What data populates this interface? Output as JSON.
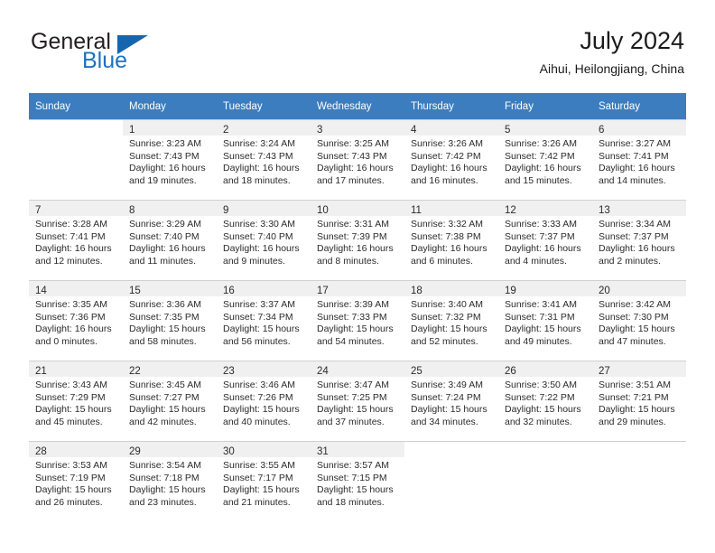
{
  "brand": {
    "word_one": "General",
    "word_two": "Blue",
    "triangle_icon": "triangle-icon",
    "colors": {
      "blue": "#1f72bd",
      "triangle": "#1566ae",
      "dark": "#231f20"
    }
  },
  "header": {
    "title": "July 2024",
    "subtitle": "Aihui, Heilongjiang, China"
  },
  "theme": {
    "header_row_bg": "#3b7dbf",
    "header_row_text": "#ffffff",
    "daynum_band_bg": "#f0f0f0",
    "grid_line": "#c8c8c8"
  },
  "weekdays": [
    "Sunday",
    "Monday",
    "Tuesday",
    "Wednesday",
    "Thursday",
    "Friday",
    "Saturday"
  ],
  "labels": {
    "sunrise": "Sunrise:",
    "sunset": "Sunset:",
    "daylight": "Daylight:"
  },
  "weeks": [
    [
      {
        "day": "",
        "sunrise": "",
        "sunset": "",
        "daylight_line1": "",
        "daylight_line2": ""
      },
      {
        "day": "1",
        "sunrise": "Sunrise: 3:23 AM",
        "sunset": "Sunset: 7:43 PM",
        "daylight_line1": "Daylight: 16 hours",
        "daylight_line2": "and 19 minutes."
      },
      {
        "day": "2",
        "sunrise": "Sunrise: 3:24 AM",
        "sunset": "Sunset: 7:43 PM",
        "daylight_line1": "Daylight: 16 hours",
        "daylight_line2": "and 18 minutes."
      },
      {
        "day": "3",
        "sunrise": "Sunrise: 3:25 AM",
        "sunset": "Sunset: 7:43 PM",
        "daylight_line1": "Daylight: 16 hours",
        "daylight_line2": "and 17 minutes."
      },
      {
        "day": "4",
        "sunrise": "Sunrise: 3:26 AM",
        "sunset": "Sunset: 7:42 PM",
        "daylight_line1": "Daylight: 16 hours",
        "daylight_line2": "and 16 minutes."
      },
      {
        "day": "5",
        "sunrise": "Sunrise: 3:26 AM",
        "sunset": "Sunset: 7:42 PM",
        "daylight_line1": "Daylight: 16 hours",
        "daylight_line2": "and 15 minutes."
      },
      {
        "day": "6",
        "sunrise": "Sunrise: 3:27 AM",
        "sunset": "Sunset: 7:41 PM",
        "daylight_line1": "Daylight: 16 hours",
        "daylight_line2": "and 14 minutes."
      }
    ],
    [
      {
        "day": "7",
        "sunrise": "Sunrise: 3:28 AM",
        "sunset": "Sunset: 7:41 PM",
        "daylight_line1": "Daylight: 16 hours",
        "daylight_line2": "and 12 minutes."
      },
      {
        "day": "8",
        "sunrise": "Sunrise: 3:29 AM",
        "sunset": "Sunset: 7:40 PM",
        "daylight_line1": "Daylight: 16 hours",
        "daylight_line2": "and 11 minutes."
      },
      {
        "day": "9",
        "sunrise": "Sunrise: 3:30 AM",
        "sunset": "Sunset: 7:40 PM",
        "daylight_line1": "Daylight: 16 hours",
        "daylight_line2": "and 9 minutes."
      },
      {
        "day": "10",
        "sunrise": "Sunrise: 3:31 AM",
        "sunset": "Sunset: 7:39 PM",
        "daylight_line1": "Daylight: 16 hours",
        "daylight_line2": "and 8 minutes."
      },
      {
        "day": "11",
        "sunrise": "Sunrise: 3:32 AM",
        "sunset": "Sunset: 7:38 PM",
        "daylight_line1": "Daylight: 16 hours",
        "daylight_line2": "and 6 minutes."
      },
      {
        "day": "12",
        "sunrise": "Sunrise: 3:33 AM",
        "sunset": "Sunset: 7:37 PM",
        "daylight_line1": "Daylight: 16 hours",
        "daylight_line2": "and 4 minutes."
      },
      {
        "day": "13",
        "sunrise": "Sunrise: 3:34 AM",
        "sunset": "Sunset: 7:37 PM",
        "daylight_line1": "Daylight: 16 hours",
        "daylight_line2": "and 2 minutes."
      }
    ],
    [
      {
        "day": "14",
        "sunrise": "Sunrise: 3:35 AM",
        "sunset": "Sunset: 7:36 PM",
        "daylight_line1": "Daylight: 16 hours",
        "daylight_line2": "and 0 minutes."
      },
      {
        "day": "15",
        "sunrise": "Sunrise: 3:36 AM",
        "sunset": "Sunset: 7:35 PM",
        "daylight_line1": "Daylight: 15 hours",
        "daylight_line2": "and 58 minutes."
      },
      {
        "day": "16",
        "sunrise": "Sunrise: 3:37 AM",
        "sunset": "Sunset: 7:34 PM",
        "daylight_line1": "Daylight: 15 hours",
        "daylight_line2": "and 56 minutes."
      },
      {
        "day": "17",
        "sunrise": "Sunrise: 3:39 AM",
        "sunset": "Sunset: 7:33 PM",
        "daylight_line1": "Daylight: 15 hours",
        "daylight_line2": "and 54 minutes."
      },
      {
        "day": "18",
        "sunrise": "Sunrise: 3:40 AM",
        "sunset": "Sunset: 7:32 PM",
        "daylight_line1": "Daylight: 15 hours",
        "daylight_line2": "and 52 minutes."
      },
      {
        "day": "19",
        "sunrise": "Sunrise: 3:41 AM",
        "sunset": "Sunset: 7:31 PM",
        "daylight_line1": "Daylight: 15 hours",
        "daylight_line2": "and 49 minutes."
      },
      {
        "day": "20",
        "sunrise": "Sunrise: 3:42 AM",
        "sunset": "Sunset: 7:30 PM",
        "daylight_line1": "Daylight: 15 hours",
        "daylight_line2": "and 47 minutes."
      }
    ],
    [
      {
        "day": "21",
        "sunrise": "Sunrise: 3:43 AM",
        "sunset": "Sunset: 7:29 PM",
        "daylight_line1": "Daylight: 15 hours",
        "daylight_line2": "and 45 minutes."
      },
      {
        "day": "22",
        "sunrise": "Sunrise: 3:45 AM",
        "sunset": "Sunset: 7:27 PM",
        "daylight_line1": "Daylight: 15 hours",
        "daylight_line2": "and 42 minutes."
      },
      {
        "day": "23",
        "sunrise": "Sunrise: 3:46 AM",
        "sunset": "Sunset: 7:26 PM",
        "daylight_line1": "Daylight: 15 hours",
        "daylight_line2": "and 40 minutes."
      },
      {
        "day": "24",
        "sunrise": "Sunrise: 3:47 AM",
        "sunset": "Sunset: 7:25 PM",
        "daylight_line1": "Daylight: 15 hours",
        "daylight_line2": "and 37 minutes."
      },
      {
        "day": "25",
        "sunrise": "Sunrise: 3:49 AM",
        "sunset": "Sunset: 7:24 PM",
        "daylight_line1": "Daylight: 15 hours",
        "daylight_line2": "and 34 minutes."
      },
      {
        "day": "26",
        "sunrise": "Sunrise: 3:50 AM",
        "sunset": "Sunset: 7:22 PM",
        "daylight_line1": "Daylight: 15 hours",
        "daylight_line2": "and 32 minutes."
      },
      {
        "day": "27",
        "sunrise": "Sunrise: 3:51 AM",
        "sunset": "Sunset: 7:21 PM",
        "daylight_line1": "Daylight: 15 hours",
        "daylight_line2": "and 29 minutes."
      }
    ],
    [
      {
        "day": "28",
        "sunrise": "Sunrise: 3:53 AM",
        "sunset": "Sunset: 7:19 PM",
        "daylight_line1": "Daylight: 15 hours",
        "daylight_line2": "and 26 minutes."
      },
      {
        "day": "29",
        "sunrise": "Sunrise: 3:54 AM",
        "sunset": "Sunset: 7:18 PM",
        "daylight_line1": "Daylight: 15 hours",
        "daylight_line2": "and 23 minutes."
      },
      {
        "day": "30",
        "sunrise": "Sunrise: 3:55 AM",
        "sunset": "Sunset: 7:17 PM",
        "daylight_line1": "Daylight: 15 hours",
        "daylight_line2": "and 21 minutes."
      },
      {
        "day": "31",
        "sunrise": "Sunrise: 3:57 AM",
        "sunset": "Sunset: 7:15 PM",
        "daylight_line1": "Daylight: 15 hours",
        "daylight_line2": "and 18 minutes."
      },
      {
        "day": "",
        "sunrise": "",
        "sunset": "",
        "daylight_line1": "",
        "daylight_line2": ""
      },
      {
        "day": "",
        "sunrise": "",
        "sunset": "",
        "daylight_line1": "",
        "daylight_line2": ""
      },
      {
        "day": "",
        "sunrise": "",
        "sunset": "",
        "daylight_line1": "",
        "daylight_line2": ""
      }
    ]
  ]
}
